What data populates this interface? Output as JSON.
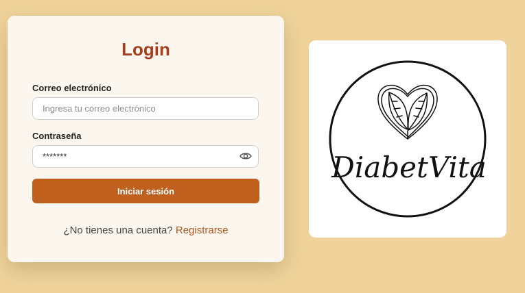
{
  "login": {
    "title": "Login",
    "email_label": "Correo electrónico",
    "email_placeholder": "Ingresa tu correo electrónico",
    "password_label": "Contraseña",
    "password_value": "*******",
    "submit_label": "Iniciar sesión",
    "register_prompt": "¿No tienes una cuenta?",
    "register_link": "Registrarse"
  },
  "logo": {
    "text": "DiabetVita",
    "icon": "heart-leaves-icon"
  },
  "colors": {
    "background": "#EFD39B",
    "card": "#FCF7EE",
    "title": "#A4401F",
    "button": "#C0601E",
    "link": "#B5541B"
  }
}
